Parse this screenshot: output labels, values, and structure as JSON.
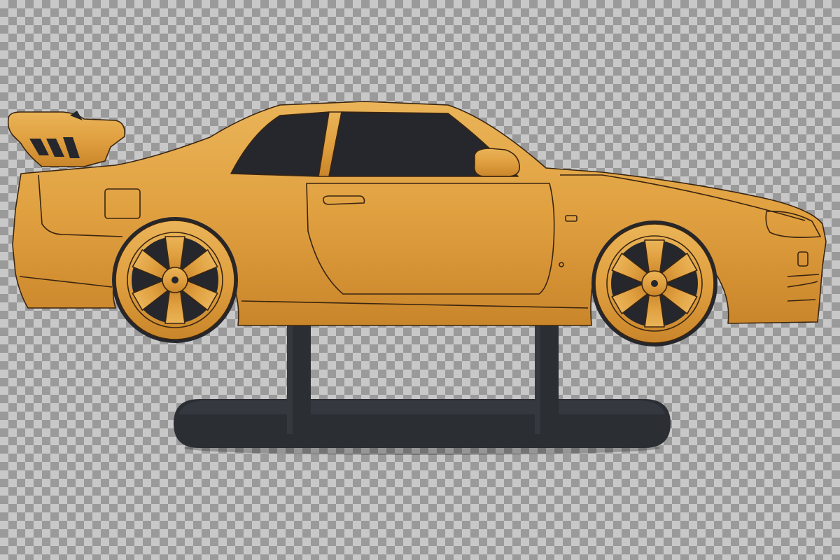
{
  "image": {
    "subject": "wooden-car-silhouette-on-stand",
    "background_pattern": "transparency-checkerboard"
  },
  "colors": {
    "checker_light": "#c8c8c8",
    "checker_dark": "#9a9a9a",
    "bamboo_base": "#e0a040",
    "bamboo_light": "#eab458",
    "bamboo_dark": "#c9852a",
    "engraving_line": "#3a2510",
    "window_felt": "#25272c",
    "stand_metal": "#2b2e33",
    "stand_highlight": "#3c4046"
  }
}
